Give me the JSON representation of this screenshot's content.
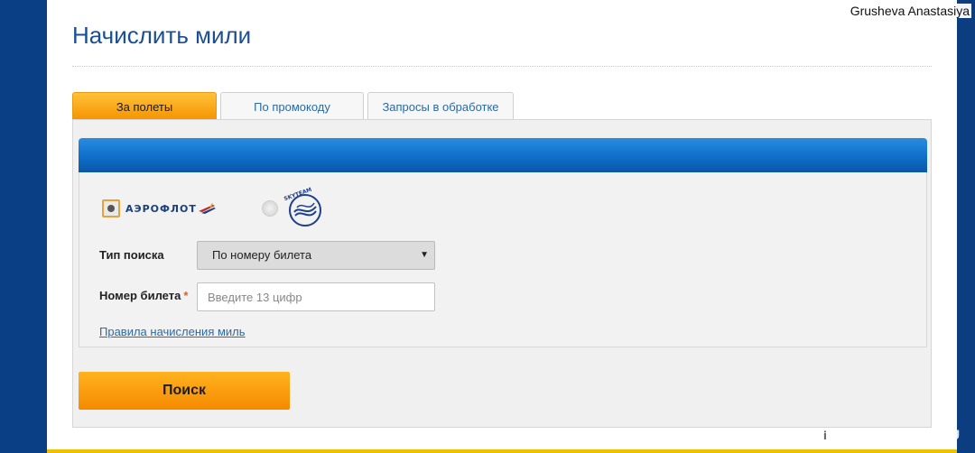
{
  "user": {
    "name": "Grusheva Anastasiya"
  },
  "page": {
    "title": "Начислить мили"
  },
  "tabs": [
    {
      "label": "За полеты",
      "active": true
    },
    {
      "label": "По промокоду",
      "active": false
    },
    {
      "label": "Запросы в обработке",
      "active": false
    }
  ],
  "airlines": {
    "aeroflot_label": "АЭРОФЛОТ",
    "skyteam_label": "SKYTEAM",
    "selected": "aeroflot"
  },
  "form": {
    "search_type_label": "Тип поиска",
    "search_type_value": "По номеру билета",
    "ticket_label": "Номер билета",
    "required_mark": "*",
    "ticket_placeholder": "Введите 13 цифр",
    "rules_link": "Правила начисления миль"
  },
  "actions": {
    "search_label": "Поиск"
  },
  "watermark": {
    "text": "RECOMMEND.RU",
    "icon_letter": "i"
  },
  "colors": {
    "frame_blue": "#0a3f86",
    "title_blue": "#1a4f93",
    "tab_orange": "#f59300",
    "bar_blue": "#0f6fc9",
    "link_blue": "#2a6aa5"
  }
}
